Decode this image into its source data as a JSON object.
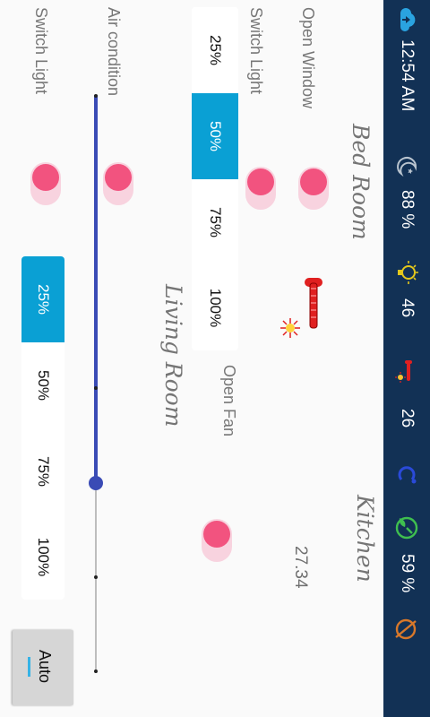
{
  "status_bar": {
    "time": "12:54 AM",
    "sky_value": "88 %",
    "light_value": "46",
    "temperature_value": "26",
    "plant_value": "59 %",
    "icons": [
      "cloud-upload-icon",
      "night-sky-icon",
      "lightbulb-icon",
      "thermometer-sun-icon",
      "humidity-c-icon",
      "plant-gauge-icon",
      "no-sensor-icon"
    ]
  },
  "bed_room": {
    "title": "Bed Room",
    "open_window_label": "Open Window",
    "switch_light_label": "Switch Light",
    "brightness_options": [
      "25%",
      "50%",
      "75%",
      "100%"
    ],
    "brightness_selected": "50%"
  },
  "living_room": {
    "title": "Living Room",
    "air_condition_label": "Air condition",
    "switch_light_label": "Switch Light",
    "brightness_options": [
      "25%",
      "50%",
      "75%",
      "100%"
    ],
    "brightness_selected": "25%",
    "slider_level": 0.67
  },
  "kitchen": {
    "title": "Kitchen",
    "open_fan_label": "Open Fan",
    "temperature_reading": "27.34"
  },
  "auto_button": {
    "label": "Auto"
  },
  "colors": {
    "status_bar_bg": "#123155",
    "accent_blue": "#0aa0d4",
    "toggle_thumb": "#f2537f",
    "toggle_track": "#f8d3df",
    "slider": "#3a4bb5"
  }
}
